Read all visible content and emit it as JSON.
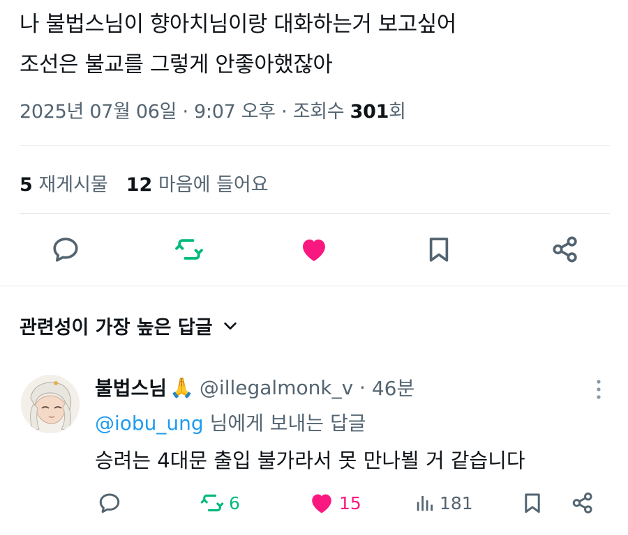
{
  "post": {
    "line1": "나 불법스님이 향아치님이랑 대화하는거 보고싶어",
    "line2": "조선은 불교를 그렇게 안좋아했잖아",
    "meta_prefix": "2025년 07월 06일 · 9:07 오후 · 조회수 ",
    "views": "301",
    "views_suffix": "회"
  },
  "stats": {
    "reposts_count": "5",
    "reposts_label": "재게시물",
    "likes_count": "12",
    "likes_label": "마음에 들어요"
  },
  "actions": {
    "icons": [
      "reply-icon",
      "repost-icon",
      "like-icon",
      "bookmark-icon",
      "share-icon"
    ]
  },
  "replies_section": {
    "title": "관련성이 가장 높은 답글"
  },
  "reply": {
    "name": "불법스님",
    "emoji": "🙏",
    "handle": "@illegalmonk_v",
    "sep": "·",
    "time": "46분",
    "replying_to": "@iobu_ung",
    "replying_suffix": " 님에게 보내는 답글",
    "text": "승려는 4대문 출입 불가라서 못 만나뵐 거 같습니다",
    "repost_count": "6",
    "like_count": "15",
    "view_count": "181"
  },
  "colors": {
    "text": "#0f1419",
    "secondary": "#536471",
    "link": "#1d9bf0",
    "repost_green": "#00ba7c",
    "like_pink": "#f91880",
    "divider": "#e7e9ea"
  }
}
